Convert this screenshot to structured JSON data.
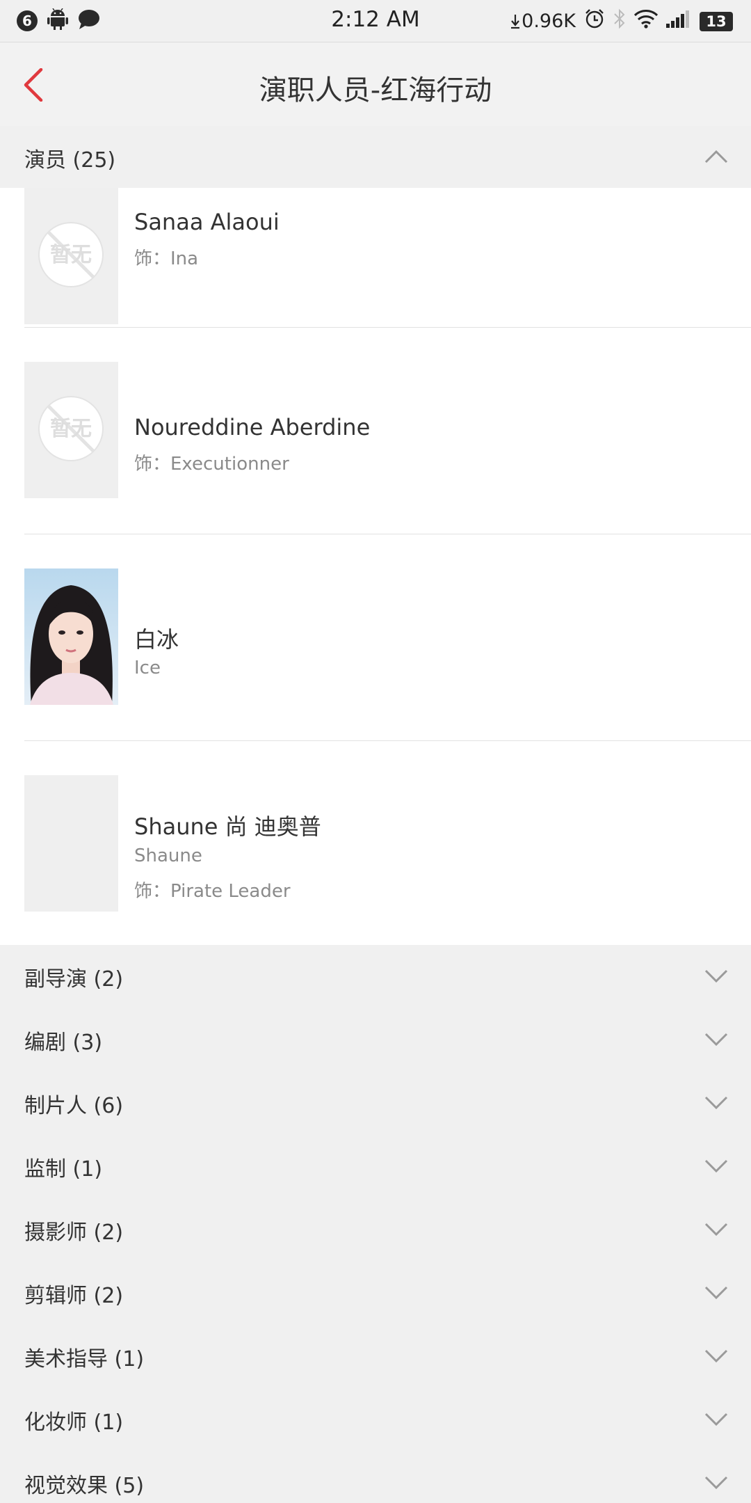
{
  "status_bar": {
    "notification_count": "6",
    "time": "2:12 AM",
    "net_speed": "0.96K",
    "battery": "13",
    "icons": [
      "android-icon",
      "chat-bubble-icon",
      "download-arrow-icon",
      "alarm-icon",
      "bluetooth-icon",
      "wifi-icon",
      "signal-icon",
      "battery-icon"
    ]
  },
  "header": {
    "title": "演职人员-红海行动",
    "back_icon": "chevron-left-icon"
  },
  "colors": {
    "accent": "#e0393e",
    "background": "#f0f0f0",
    "card": "#ffffff",
    "primary_text": "#333333",
    "secondary_text": "#8a8a8a"
  },
  "actors_section": {
    "label": "演员 (25)",
    "expanded": true,
    "no_photo_text": "暂无",
    "items": [
      {
        "name": "Sanaa Alaoui",
        "role": "饰：Ina",
        "photo": "placeholder"
      },
      {
        "name": "Noureddine Aberdine",
        "role": "饰：Executionner",
        "photo": "placeholder"
      },
      {
        "name": "白冰",
        "english_name": "Ice",
        "photo": "portrait"
      },
      {
        "name": "Shaune 尚 迪奥普",
        "english_name": "Shaune",
        "role": "饰：Pirate Leader",
        "photo": "blank"
      }
    ]
  },
  "sections": [
    {
      "label": "副导演 (2)"
    },
    {
      "label": "编剧 (3)"
    },
    {
      "label": "制片人 (6)"
    },
    {
      "label": "监制 (1)"
    },
    {
      "label": "摄影师 (2)"
    },
    {
      "label": "剪辑师 (2)"
    },
    {
      "label": "美术指导 (1)"
    },
    {
      "label": "化妆师 (1)"
    },
    {
      "label": "视觉效果 (5)"
    }
  ]
}
